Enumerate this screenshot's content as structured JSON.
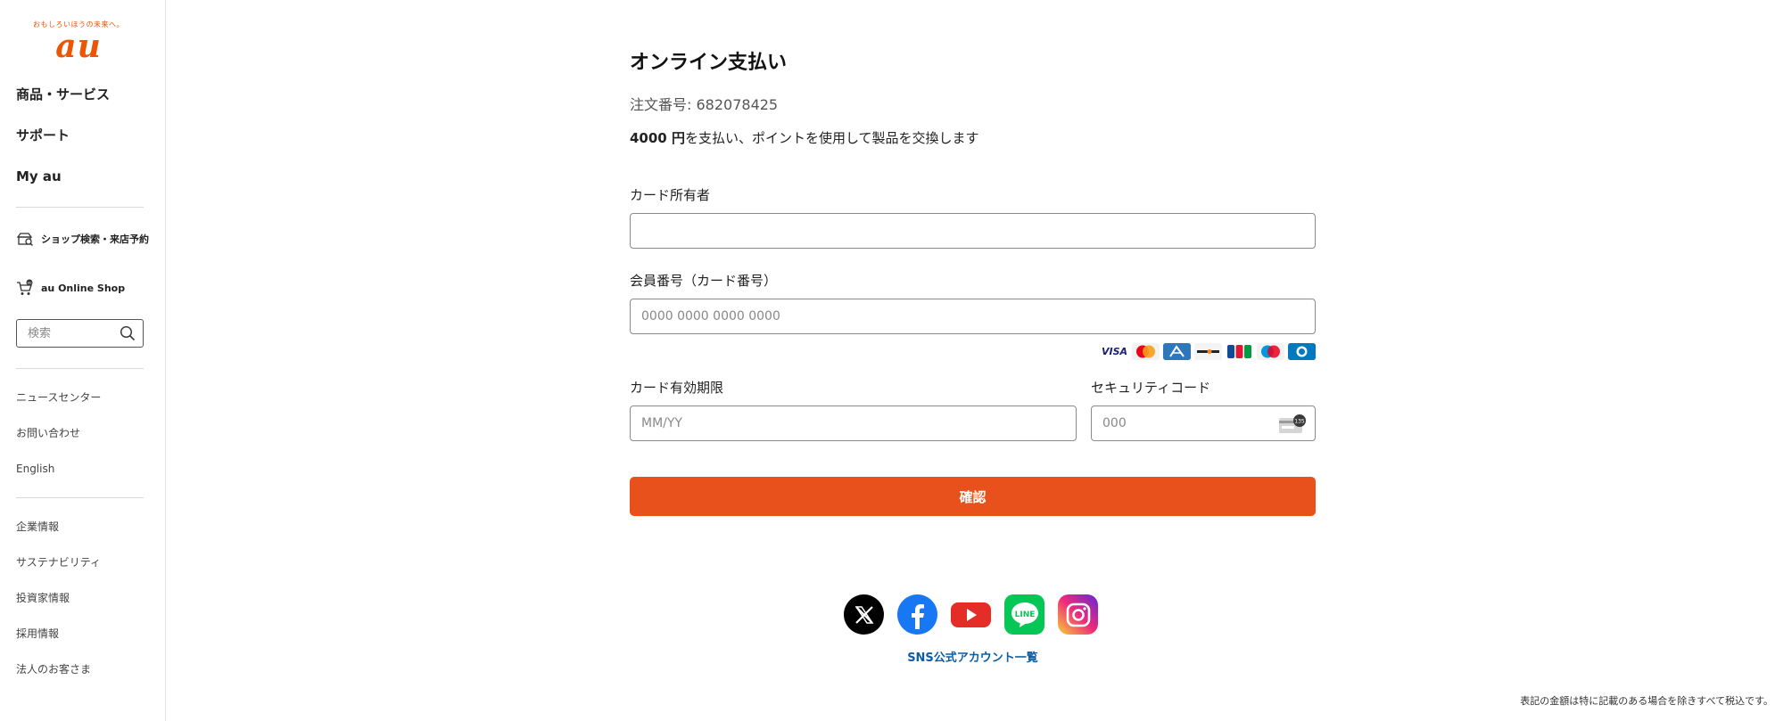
{
  "brand": {
    "tagline": "おもしろいほうの未来へ。",
    "logo_text": "au",
    "accent": "#eb5505"
  },
  "sidebar": {
    "main_nav": [
      {
        "label": "商品・サービス"
      },
      {
        "label": "サポート"
      },
      {
        "label": "My au"
      }
    ],
    "icon_links": [
      {
        "label": "ショップ検索・来店予約",
        "icon": "shop-search-icon"
      },
      {
        "label": "au Online Shop",
        "icon": "cart-icon"
      }
    ],
    "search": {
      "placeholder": "検索",
      "value": ""
    },
    "secondary": [
      {
        "label": "ニュースセンター"
      },
      {
        "label": "お問い合わせ"
      },
      {
        "label": "English"
      }
    ],
    "corporate": [
      {
        "label": "企業情報"
      },
      {
        "label": "サステナビリティ"
      },
      {
        "label": "投資家情報"
      },
      {
        "label": "採用情報"
      },
      {
        "label": "法人のお客さま"
      }
    ]
  },
  "payment": {
    "title": "オンライン支払い",
    "order_label": "注文番号: ",
    "order_number": "682078425",
    "amount": "4000 円",
    "amount_desc": "を支払い、ポイントを使用して製品を交換します",
    "card_holder": {
      "label": "カード所有者",
      "value": "",
      "placeholder": ""
    },
    "card_number": {
      "label": "会員番号（カード番号）",
      "value": "",
      "placeholder": "0000 0000 0000 0000"
    },
    "card_brands": [
      "VISA",
      "MasterCard",
      "AMEX",
      "DISCOVER",
      "JCB",
      "Maestro",
      "Diners Club"
    ],
    "expiry": {
      "label": "カード有効期限",
      "value": "",
      "placeholder": "MM/YY"
    },
    "cvc": {
      "label": "セキュリティコード",
      "value": "",
      "placeholder": "000",
      "icon_text": "135"
    },
    "confirm_label": "確認",
    "confirm_color": "#e8501c"
  },
  "footer": {
    "sns": [
      "x-icon",
      "facebook-icon",
      "youtube-icon",
      "line-icon",
      "instagram-icon"
    ],
    "sns_link": "SNS公式アカウント一覧",
    "tax_note": "表記の金額は特に記載のある場合を除きすべて税込です。"
  }
}
